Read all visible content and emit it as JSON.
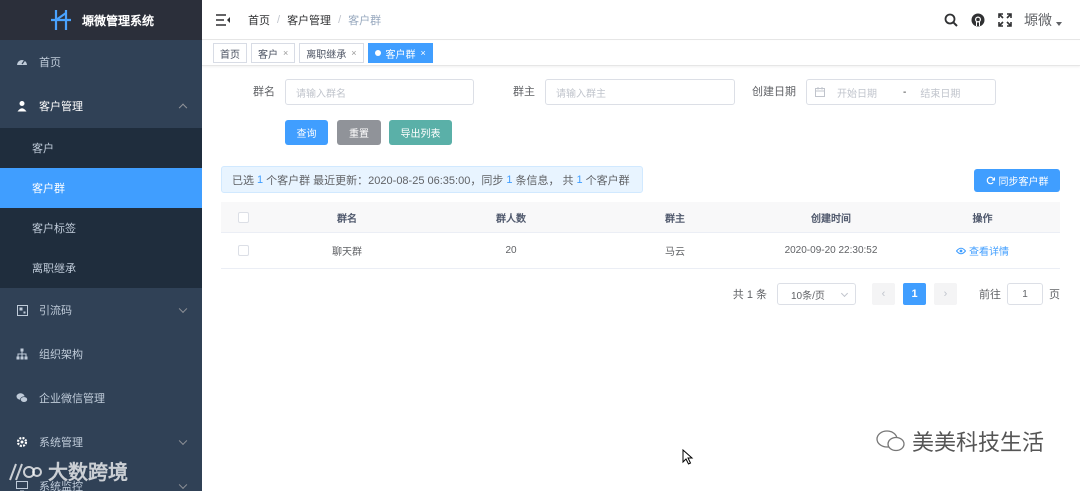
{
  "app": {
    "title": "塬微管理系统"
  },
  "sidebar": {
    "items": [
      {
        "label": "首页",
        "icon": "dashboard-icon"
      },
      {
        "label": "客户管理",
        "icon": "user-icon",
        "expanded": true,
        "children": [
          {
            "label": "客户"
          },
          {
            "label": "客户群",
            "active": true
          },
          {
            "label": "客户标签"
          },
          {
            "label": "离职继承"
          }
        ]
      },
      {
        "label": "引流码",
        "icon": "qrcode-icon"
      },
      {
        "label": "组织架构",
        "icon": "tree-icon"
      },
      {
        "label": "企业微信管理",
        "icon": "wechat-icon"
      },
      {
        "label": "系统管理",
        "icon": "gear-icon"
      },
      {
        "label": "系统监控",
        "icon": "monitor-icon"
      }
    ]
  },
  "header": {
    "breadcrumb": [
      "首页",
      "客户管理",
      "客户群"
    ],
    "user": "塬微"
  },
  "tags": [
    {
      "label": "首页",
      "closable": false
    },
    {
      "label": "客户",
      "closable": true
    },
    {
      "label": "离职继承",
      "closable": true
    },
    {
      "label": "客户群",
      "closable": true,
      "active": true
    }
  ],
  "filters": {
    "group_name": {
      "label": "群名",
      "placeholder": "请输入群名"
    },
    "group_owner": {
      "label": "群主",
      "placeholder": "请输入群主"
    },
    "created_date": {
      "label": "创建日期",
      "start_placeholder": "开始日期",
      "separator": "-",
      "end_placeholder": "结束日期"
    }
  },
  "buttons": {
    "search": "查询",
    "reset": "重置",
    "export": "导出列表",
    "sync": "同步客户群"
  },
  "info": {
    "prefix": "已选",
    "selected": "1",
    "mid": "个客户群 最近更新：2020-08-25 06:35:00，同步",
    "synced": "1",
    "mid2": "条信息， 共",
    "total": "1",
    "suffix": "个客户群"
  },
  "table": {
    "columns": [
      "群名",
      "群人数",
      "群主",
      "创建时间",
      "操作"
    ],
    "rows": [
      {
        "name": "聊天群",
        "count": "20",
        "owner": "马云",
        "created": "2020-09-20 22:30:52",
        "action": "查看详情"
      }
    ]
  },
  "pagination": {
    "total_text": "共 1 条",
    "page_size": "10条/页",
    "current": "1",
    "goto_prefix": "前往",
    "goto_value": "1",
    "goto_suffix": "页"
  },
  "watermarks": {
    "right": "美美科技生活",
    "left": "大数跨境"
  },
  "colors": {
    "sidebar_bg": "#304156",
    "primary": "#409eff",
    "gray": "#909399",
    "teal": "#5ab0a8"
  }
}
